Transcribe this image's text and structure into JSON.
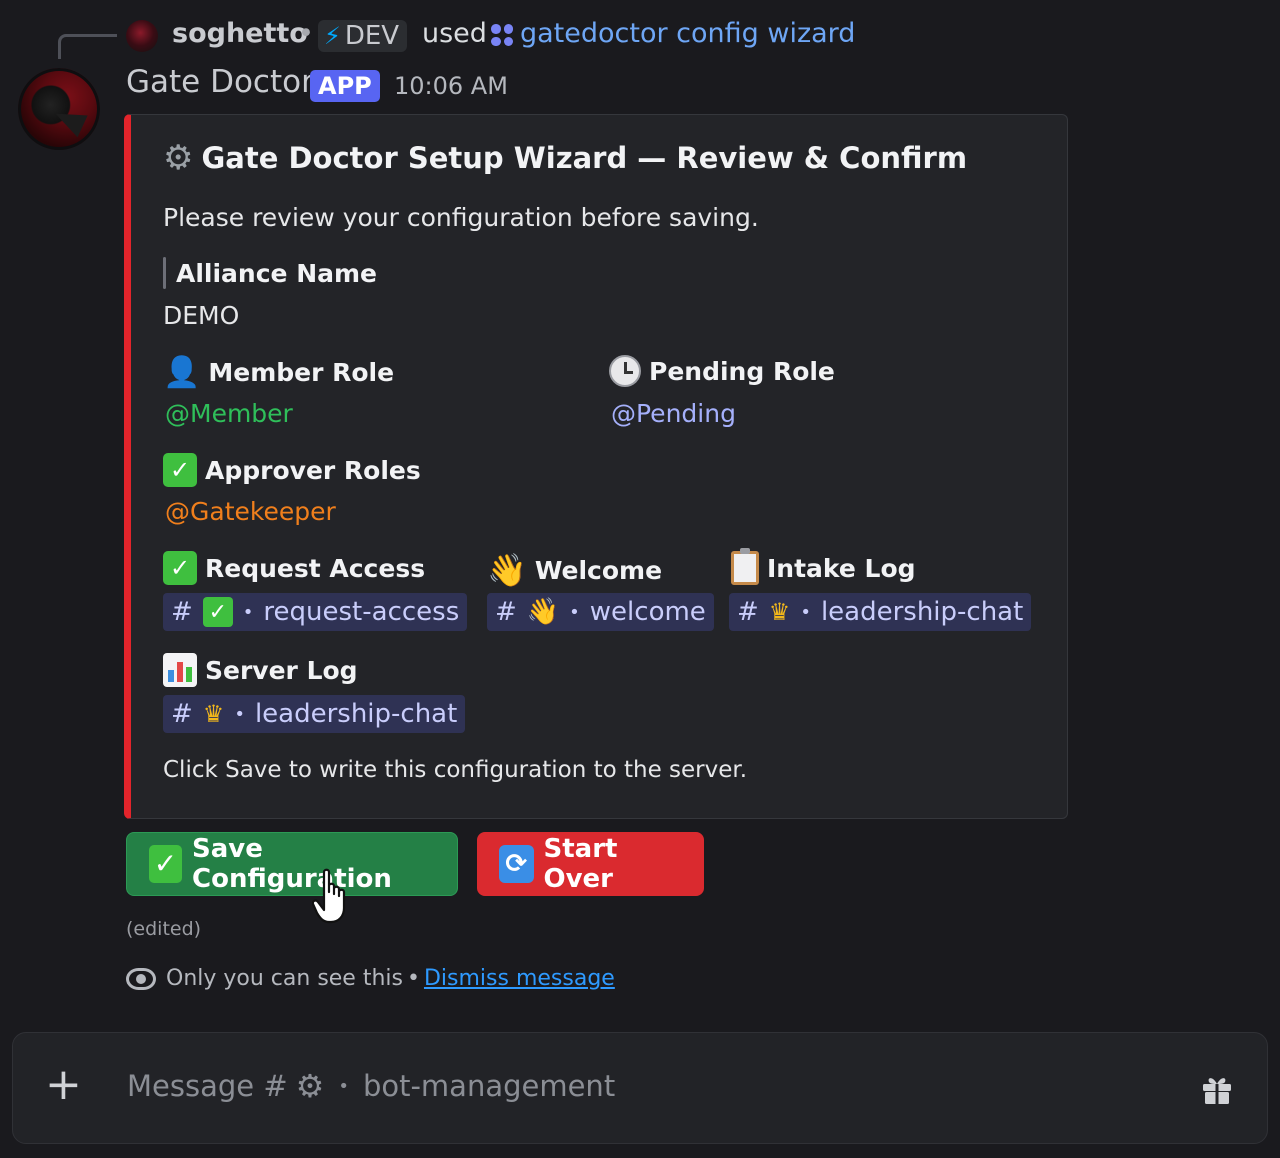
{
  "reply": {
    "username": "soghetto",
    "separator": "•",
    "tag_label": "DEV",
    "used_text": "used",
    "command_name": "gatedoctor config wizard"
  },
  "message": {
    "author": "Gate Doctor",
    "badge": "APP",
    "timestamp": "10:06 AM"
  },
  "embed": {
    "accent_color": "#e3242b",
    "title": "Gate Doctor Setup Wizard — Review & Confirm",
    "description": "Please review your configuration before saving.",
    "fields": {
      "alliance": {
        "name": "Alliance Name",
        "value": "DEMO"
      },
      "member_role": {
        "name": "Member Role",
        "value": "@Member"
      },
      "pending_role": {
        "name": "Pending Role",
        "value": "@Pending"
      },
      "approver_roles": {
        "name": "Approver Roles",
        "value": "@Gatekeeper"
      },
      "request_access": {
        "name": "Request Access",
        "channel": "request-access"
      },
      "welcome": {
        "name": "Welcome",
        "channel": "welcome"
      },
      "intake_log": {
        "name": "Intake Log",
        "channel": "leadership-chat"
      },
      "server_log": {
        "name": "Server Log",
        "channel": "leadership-chat"
      }
    },
    "footer": "Click Save to write this configuration to the server."
  },
  "buttons": {
    "save_label": "Save Configuration",
    "start_over_label": "Start Over",
    "save_color": "#248046",
    "start_over_color": "#da2a2f"
  },
  "edited_label": "(edited)",
  "ephemeral": {
    "notice": "Only you can see this",
    "separator": "•",
    "dismiss_label": "Dismiss message"
  },
  "composer": {
    "placeholder_prefix": "Message #",
    "channel": "bot-management",
    "separator": "•"
  },
  "symbols": {
    "hash": "#",
    "dot": "•",
    "check": "✓",
    "refresh": "⟳",
    "gear": "⚙",
    "plus": "+",
    "bolt": "⚡",
    "person": "👤",
    "wave": "👋",
    "crown": "♛"
  }
}
